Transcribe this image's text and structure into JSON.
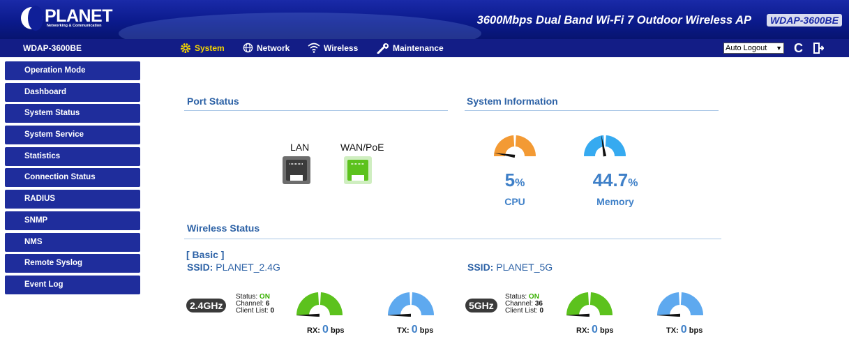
{
  "brand": {
    "logo_text": "PLANET",
    "logo_sub": "Networking & Communication"
  },
  "header": {
    "product_title": "3600Mbps Dual Band Wi-Fi 7 Outdoor Wireless AP",
    "model_badge": "WDAP-3600BE"
  },
  "navbar": {
    "device_name": "WDAP-3600BE",
    "items": [
      {
        "label": "System",
        "icon": "gear-icon",
        "active": true
      },
      {
        "label": "Network",
        "icon": "globe-icon",
        "active": false
      },
      {
        "label": "Wireless",
        "icon": "wifi-icon",
        "active": false
      },
      {
        "label": "Maintenance",
        "icon": "wrench-icon",
        "active": false
      }
    ],
    "auto_logout": "Auto Logout",
    "icons": [
      "refresh-icon",
      "logout-icon"
    ]
  },
  "sidebar": {
    "items": [
      {
        "label": "Operation Mode"
      },
      {
        "label": "Dashboard"
      },
      {
        "label": "System Status"
      },
      {
        "label": "System Service"
      },
      {
        "label": "Statistics"
      },
      {
        "label": "Connection Status"
      },
      {
        "label": "RADIUS"
      },
      {
        "label": "SNMP"
      },
      {
        "label": "NMS"
      },
      {
        "label": "Remote Syslog"
      },
      {
        "label": "Event Log"
      }
    ]
  },
  "port_status": {
    "title": "Port Status",
    "ports": [
      {
        "label": "LAN",
        "state": "down",
        "color": "#3b3b3b"
      },
      {
        "label": "WAN/PoE",
        "state": "up",
        "color": "#5cc21d"
      }
    ]
  },
  "system_info": {
    "title": "System Information",
    "cpu": {
      "value": "5",
      "unit": "%",
      "label": "CPU",
      "fraction": 0.05,
      "color": "#f39a34"
    },
    "memory": {
      "value": "44.7",
      "unit": "%",
      "label": "Memory",
      "fraction": 0.447,
      "color": "#36aaf0"
    }
  },
  "wireless_status": {
    "title": "Wireless Status",
    "mode_label": "[ Basic ]",
    "ssid_label": "SSID:",
    "radios": [
      {
        "ssid": "PLANET_2.4G",
        "band": "2.4GHz",
        "status_label": "Status:",
        "status": "ON",
        "channel_label": "Channel:",
        "channel": "6",
        "client_label": "Client List:",
        "clients": "0",
        "rx_label": "RX:",
        "rx": "0",
        "rx_unit": "bps",
        "tx_label": "TX:",
        "tx": "0",
        "tx_unit": "bps"
      },
      {
        "ssid": "PLANET_5G",
        "band": "5GHz",
        "status_label": "Status:",
        "status": "ON",
        "channel_label": "Channel:",
        "channel": "36",
        "client_label": "Client List:",
        "clients": "0",
        "rx_label": "RX:",
        "rx": "0",
        "rx_unit": "bps",
        "tx_label": "TX:",
        "tx": "0",
        "tx_unit": "bps"
      }
    ],
    "rx_color": "#5cc21d",
    "tx_color": "#5ea9ef"
  }
}
